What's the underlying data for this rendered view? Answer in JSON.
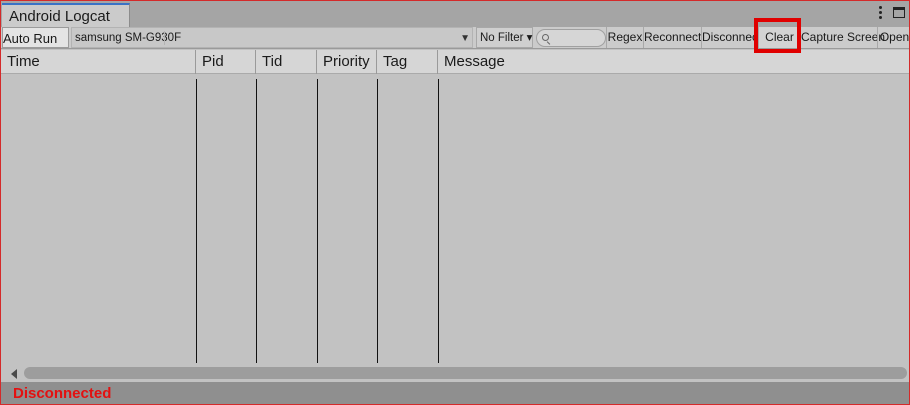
{
  "window": {
    "title": "Android Logcat"
  },
  "toolbar": {
    "auto_run_label": "Auto Run",
    "device_selected": "samsung SM-G930F",
    "filter_label": "No Filter ▾",
    "search_placeholder": "",
    "regex_label": "Regex",
    "reconnect_label": "Reconnect",
    "disconnect_label": "Disconnect",
    "clear_label": "Clear",
    "capture_label": "Capture Screen",
    "open_label": "Open"
  },
  "table": {
    "columns": [
      "Time",
      "Pid",
      "Tid",
      "Priority",
      "Tag",
      "Message"
    ],
    "rows": []
  },
  "status": {
    "text": "Disconnected",
    "color": "#e41010"
  },
  "colors": {
    "highlight": "#e00000",
    "tab_accent": "#3a72c6"
  },
  "icons": [
    "kebab-menu-icon",
    "maximize-icon",
    "dropdown-caret-icon",
    "search-icon",
    "scroll-left-icon"
  ]
}
